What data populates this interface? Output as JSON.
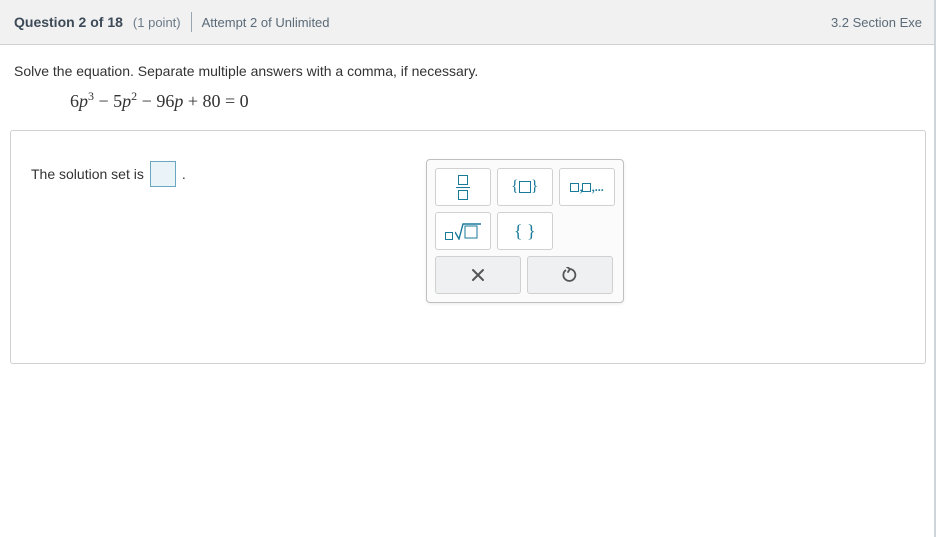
{
  "header": {
    "question_label": "Question 2 of 18",
    "points": "(1 point)",
    "attempt": "Attempt 2 of Unlimited",
    "section": "3.2 Section Exe"
  },
  "prompt": "Solve the equation. Separate multiple answers with a comma, if necessary.",
  "equation_parts": {
    "a": "6",
    "b": "5",
    "c": "96",
    "d": "80",
    "rhs": "0"
  },
  "solution_label": "The solution set is",
  "period": ".",
  "palette": {
    "set_braces_label": "{ }",
    "list_label": "▫,▫,...",
    "empty_braces_label": "{ }",
    "clear_label": "×",
    "undo_label": "↺"
  }
}
